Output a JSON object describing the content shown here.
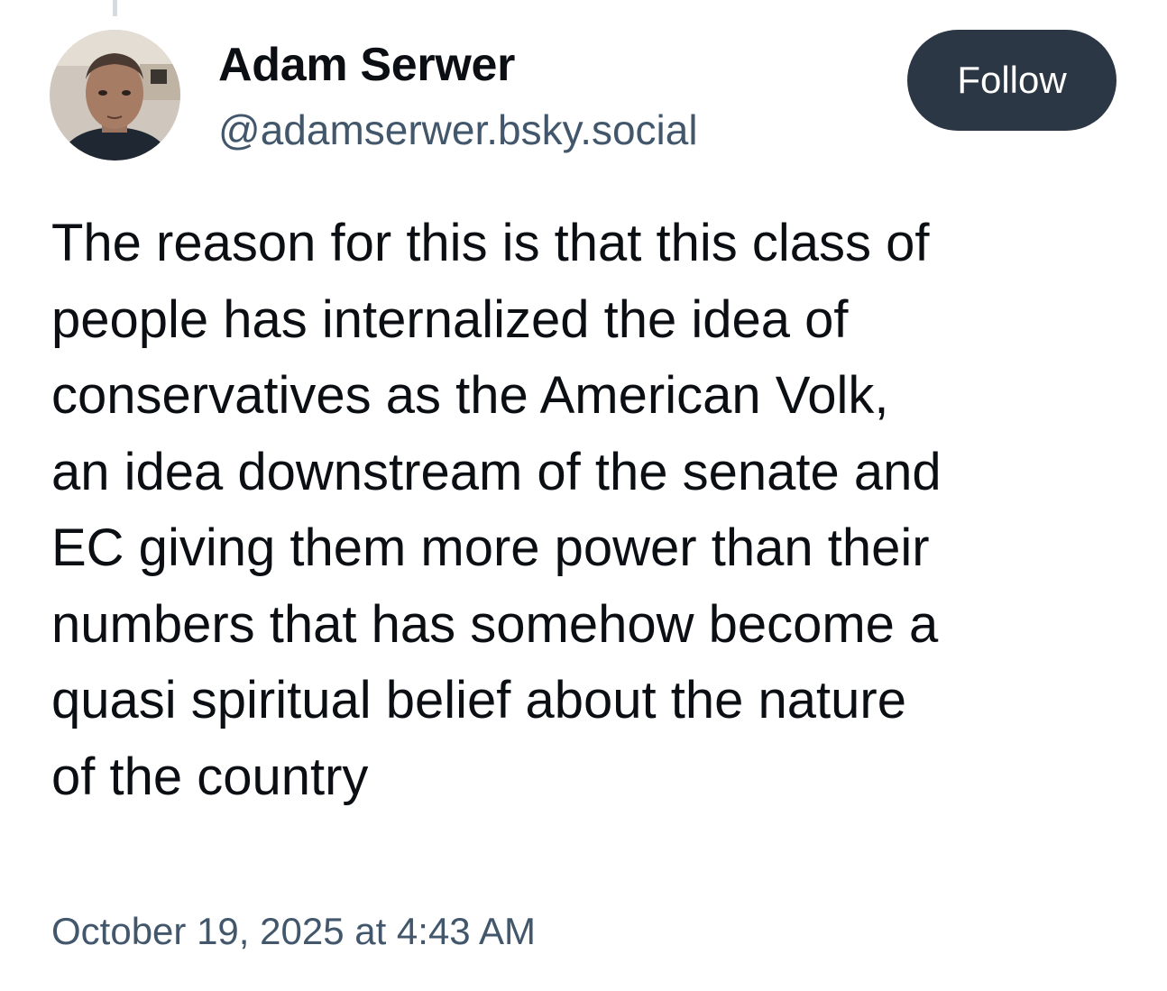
{
  "author": {
    "display_name": "Adam Serwer",
    "handle": "@adamserwer.bsky.social"
  },
  "follow_button": {
    "label": "Follow"
  },
  "post": {
    "text": "The reason for this is that this class of\npeople has internalized the idea of\nconservatives as the American Volk,\nan idea downstream of the senate and\nEC giving them more power than their\nnumbers that has somehow become a\nquasi spiritual belief about the nature\nof the country",
    "timestamp": "October 19, 2025 at 4:43 AM"
  },
  "colors": {
    "text_primary": "#0b0f14",
    "text_secondary": "#42576c",
    "follow_button_bg": "#2b3744",
    "thread_line": "#d4dbe2"
  },
  "icons": {
    "avatar": "user-photo"
  }
}
